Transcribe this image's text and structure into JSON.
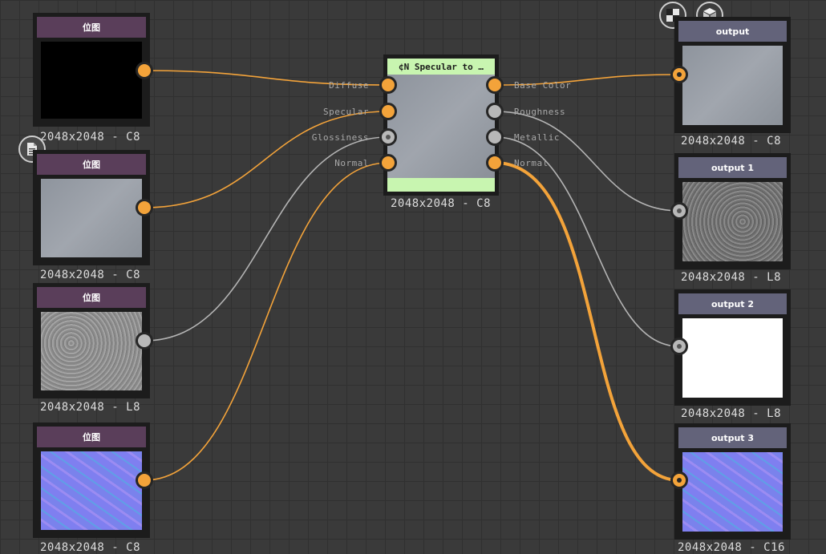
{
  "input_nodes": [
    {
      "title": "位图",
      "resolution": "2048x2048 - C8"
    },
    {
      "title": "位图",
      "resolution": "2048x2048 - C8"
    },
    {
      "title": "位图",
      "resolution": "2048x2048 - L8"
    },
    {
      "title": "位图",
      "resolution": "2048x2048 - C8"
    }
  ],
  "center_node": {
    "title": "¢N Specular to …",
    "resolution": "2048x2048 - C8",
    "inputs": [
      "Diffuse",
      "Specular",
      "Glossiness",
      "Normal"
    ],
    "outputs": [
      "Base Color",
      "Roughness",
      "Metallic",
      "Normal"
    ]
  },
  "output_nodes": [
    {
      "title": "output",
      "resolution": "2048x2048 - C8"
    },
    {
      "title": "output 1",
      "resolution": "2048x2048 - L8"
    },
    {
      "title": "output 2",
      "resolution": "2048x2048 - L8"
    },
    {
      "title": "output 3",
      "resolution": "2048x2048 - C16"
    }
  ],
  "colors": {
    "background": "#3a3a3a",
    "wire_color": "#f3a33a",
    "wire_greyscale": "#b4b4b4",
    "input_header": "#5a3e5a",
    "output_header": "#63637a",
    "center_header": "#c8f5b0"
  },
  "icons": {
    "comment": "document-icon",
    "view_2d": "checker-2d-icon",
    "view_3d": "cube-3d-icon"
  }
}
